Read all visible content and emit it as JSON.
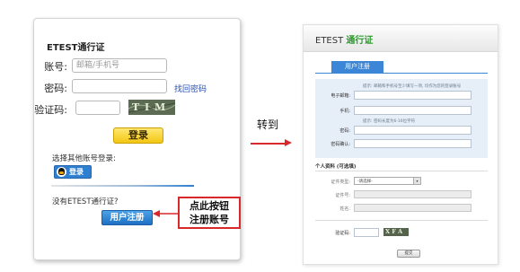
{
  "login": {
    "title": "ETEST通行证",
    "account_label": "账号:",
    "account_placeholder": "邮箱/手机号",
    "password_label": "密码:",
    "forgot_link": "找回密码",
    "captcha_label": "验证码:",
    "captcha_text": "T I M B",
    "login_button": "登录",
    "other_login_label": "选择其他账号登录:",
    "qq_button": "登录",
    "no_account_text": "没有ETEST通行证?",
    "register_button": "用户注册",
    "callout_line1": "点此按钮",
    "callout_line2": "注册账号"
  },
  "arrow": {
    "label": "转到"
  },
  "register_page": {
    "brand_prefix": "ETEST ",
    "brand_highlight": "通行证",
    "tab": "用户注册",
    "email_label": "电子邮箱:",
    "email_hint": "提示: 邮箱和手机号至少填写一项, 均作为您的登录账号",
    "phone_label": "手机:",
    "password_label": "密码:",
    "password_hint": "提示: 密码长度为6-16位字符",
    "confirm_label": "密码确认:",
    "section_title": "个人资料 (可选填)",
    "id_type_label": "证件类型:",
    "id_type_value": "-请选择-",
    "id_number_label": "证件号:",
    "name_label": "姓名:",
    "captcha_label": "验证码:",
    "captcha_text": "X F A L",
    "submit_button": "提交"
  },
  "colors": {
    "accent_red": "#d8282c",
    "tab_blue": "#3b86d6",
    "brand_green": "#2e9a2e",
    "login_yellow": "#f3c613"
  },
  "icons": [
    "qq-penguin-icon",
    "arrow-right-icon",
    "select-arrow-icon"
  ]
}
